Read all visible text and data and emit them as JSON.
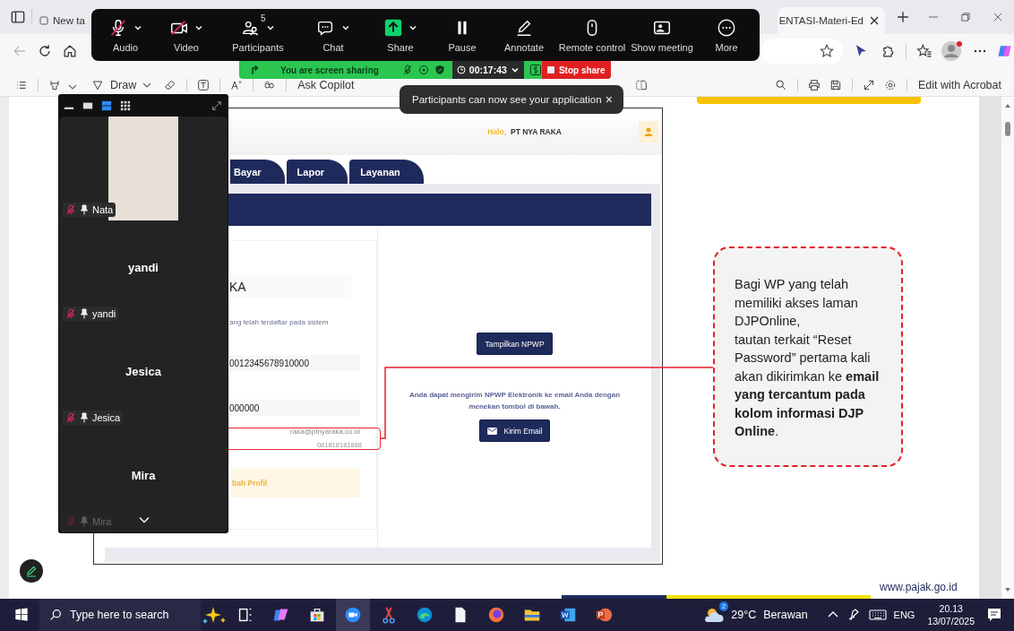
{
  "browser": {
    "tabs": [
      {
        "title": "New ta",
        "selected": false
      },
      {
        "title": "ENTASI-Materi-Ed",
        "selected": true
      }
    ],
    "pdf_toolbar": {
      "draw": "Draw",
      "ask_copilot": "Ask Copilot",
      "edit_with_acrobat": "Edit with Acrobat"
    }
  },
  "meeting_toolbar": {
    "buttons": [
      {
        "label": "Audio",
        "kind": "audio",
        "muted": true,
        "menu": true
      },
      {
        "label": "Video",
        "kind": "video",
        "muted": true,
        "menu": true
      },
      {
        "label": "Participants",
        "kind": "participants",
        "count": "5",
        "menu": true
      },
      {
        "label": "Chat",
        "kind": "chat",
        "menu": true
      },
      {
        "label": "Share",
        "kind": "share",
        "menu": true
      },
      {
        "label": "Pause",
        "kind": "pause",
        "menu": false
      },
      {
        "label": "Annotate",
        "kind": "annotate",
        "menu": false
      },
      {
        "label": "Remote control",
        "kind": "remote",
        "menu": false
      },
      {
        "label": "Show meeting",
        "kind": "meeting",
        "menu": false
      },
      {
        "label": "More",
        "kind": "more",
        "menu": false
      }
    ]
  },
  "share_bar": {
    "message": "You are screen sharing",
    "timer": "00:17:43",
    "stop": "Stop share"
  },
  "toast": {
    "message": "Participants can now see your application",
    "close": "×"
  },
  "gallery": {
    "view_modes": [
      {
        "kind": "minimize",
        "selected": false
      },
      {
        "kind": "single",
        "selected": false
      },
      {
        "kind": "speaker",
        "selected": true
      },
      {
        "kind": "grid",
        "selected": false
      }
    ],
    "tiles": [
      {
        "kind": "video",
        "label": "Nata",
        "muted": true,
        "faded": false
      },
      {
        "kind": "name",
        "heading": "yandi",
        "label": "yandi",
        "muted": true,
        "faded": false
      },
      {
        "kind": "name",
        "heading": "Jesica",
        "label": "Jesica",
        "muted": true,
        "faded": false
      },
      {
        "kind": "name",
        "heading": "Mira",
        "label": "Mira",
        "muted": true,
        "faded": true
      }
    ]
  },
  "slide": {
    "app": {
      "greeting": "Halo,",
      "user": "PT NYA RAKA",
      "tabs": [
        "Bayar",
        "Lapor",
        "Layanan"
      ],
      "name": "KA",
      "note": "ang telah terdaftar pada sistem",
      "npwp": "0012345678910000",
      "field_2": "000000",
      "email": "raka@ptnyaraka.co.id",
      "phone": "081818181888",
      "profile_button": "bah Profil",
      "show_button": "Tampilkan NPWP",
      "send_note": "Anda dapat mengirim NPWP Elektronik ke email Anda dengan menekan tombol di bawah.",
      "send_button": "Kirim Email"
    },
    "callout": "Bagi WP yang telah memiliki akses laman DJPOnline,\ntautan terkait “Reset Password” pertama kali akan dikirimkan ke **email yang tercantum pada kolom informasi DJP Online**.",
    "footer": "www.pajak.go.id"
  },
  "taskbar": {
    "search_placeholder": "Type here to search",
    "weather_badge": "2",
    "temperature": "29°C",
    "weather": "Berawan",
    "language": "ENG",
    "time": "20.13",
    "date": "13/07/2025"
  }
}
